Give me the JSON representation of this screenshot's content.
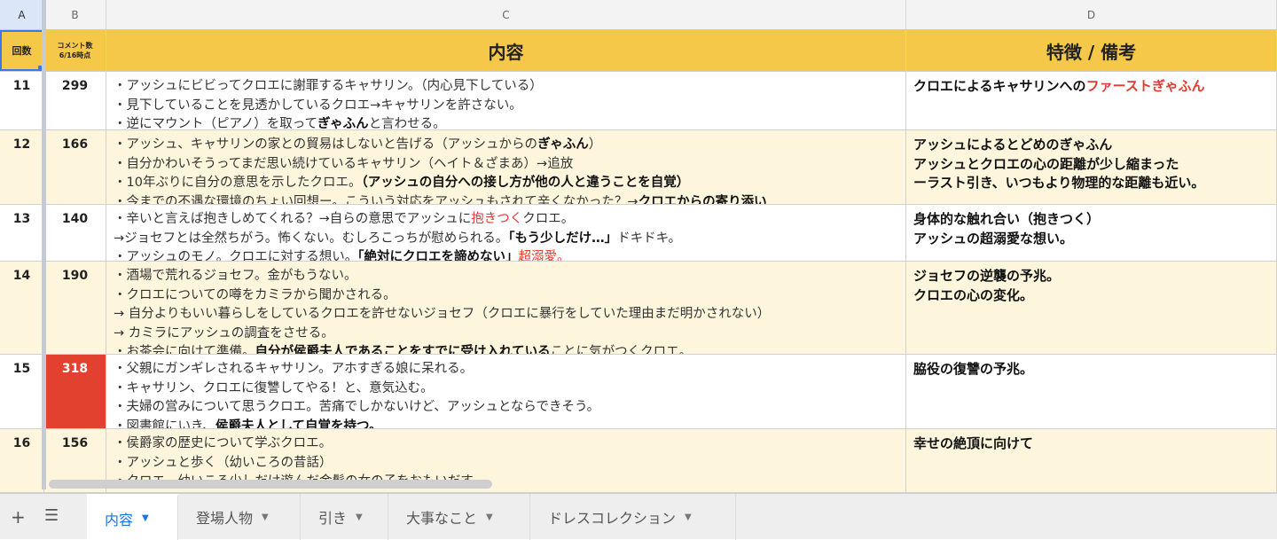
{
  "columns": [
    "A",
    "B",
    "C",
    "D"
  ],
  "header": {
    "a": "回数",
    "b_line1": "コメント数",
    "b_line2": "6/16時点",
    "c": "内容",
    "d": "特徴 / 備考"
  },
  "rows": [
    {
      "num": "11",
      "comments": "299",
      "lines": [
        [
          {
            "t": "・アッシュにビビってクロエに謝罪するキャサリン。（内心見下している）"
          }
        ],
        [
          {
            "t": "・見下していることを見透かしているクロエ→キャサリンを許さない。"
          }
        ],
        [
          {
            "t": "・逆にマウント（ピアノ）を取って"
          },
          {
            "t": "ぎゃふん",
            "s": "b"
          },
          {
            "t": "と言わせる。"
          }
        ]
      ],
      "feat": [
        [
          {
            "t": "クロエによるキャサリンへの"
          },
          {
            "t": "ファーストぎゃふん",
            "s": "red"
          }
        ]
      ]
    },
    {
      "num": "12",
      "comments": "166",
      "lines": [
        [
          {
            "t": "・アッシュ、キャサリンの家との貿易はしないと告げる（アッシュからの"
          },
          {
            "t": "ぎゃふん",
            "s": "b"
          },
          {
            "t": "）"
          }
        ],
        [
          {
            "t": "・自分かわいそうってまだ思い続けているキャサリン（ヘイト＆ざまあ）→追放"
          }
        ],
        [
          {
            "t": "・10年ぶりに自分の意思を示したクロエ。"
          },
          {
            "t": "（アッシュの自分への接し方が他の人と違うことを自覚）",
            "s": "b"
          }
        ],
        [
          {
            "t": "・今までの不遇な環境のちょい回想ー。こういう対応をアッシュもされて辛くなかった？→"
          },
          {
            "t": "クロエからの寄り添い",
            "s": "b"
          }
        ]
      ],
      "feat": [
        [
          {
            "t": "アッシュによるとどめのぎゃふん"
          }
        ],
        [
          {
            "t": "アッシュとクロエの心の距離が少し縮まった"
          }
        ],
        [
          {
            "t": "ーラスト引き、いつもより物理的な距離も近い。"
          }
        ]
      ]
    },
    {
      "num": "13",
      "comments": "140",
      "lines": [
        [
          {
            "t": "・辛いと言えば抱きしめてくれる？→自らの意思でアッシュに"
          },
          {
            "t": "抱きつく",
            "s": "red"
          },
          {
            "t": "クロエ。"
          }
        ],
        [
          {
            "t": "→ジョセフとは全然ちがう。怖くない。むしろこっちが慰められる。"
          },
          {
            "t": "「もう少しだけ…」",
            "s": "b"
          },
          {
            "t": "ドキドキ。"
          }
        ],
        [
          {
            "t": "・アッシュのモノ。クロエに対する想い。"
          },
          {
            "t": "「絶対にクロエを諦めない」",
            "s": "b"
          },
          {
            "t": "超溺愛。",
            "s": "red"
          }
        ]
      ],
      "feat": [
        [
          {
            "t": "身体的な触れ合い（抱きつく）"
          }
        ],
        [
          {
            "t": "アッシュの超溺愛な想い。"
          }
        ]
      ]
    },
    {
      "num": "14",
      "comments": "190",
      "lines": [
        [
          {
            "t": "・酒場で荒れるジョセフ。金がもうない。"
          }
        ],
        [
          {
            "t": "・クロエについての噂をカミラから聞かされる。"
          }
        ],
        [
          {
            "t": "→ 自分よりもいい暮らしをしているクロエを許せないジョセフ（クロエに暴行をしていた理由まだ明かされない）"
          }
        ],
        [
          {
            "t": "→ カミラにアッシュの調査をさせる。"
          }
        ],
        [
          {
            "t": "・お茶会に向けて準備。"
          },
          {
            "t": "自分が侯爵夫人であることをすでに受け入れている",
            "s": "b"
          },
          {
            "t": "ことに気がつくクロエ。"
          }
        ]
      ],
      "feat": [
        [
          {
            "t": "ジョセフの逆襲の予兆。"
          }
        ],
        [
          {
            "t": "クロエの心の変化。"
          }
        ]
      ]
    },
    {
      "num": "15",
      "comments": "318",
      "highlight": true,
      "lines": [
        [
          {
            "t": "・父親にガンギレされるキャサリン。アホすぎる娘に呆れる。"
          }
        ],
        [
          {
            "t": "・キャサリン、クロエに復讐してやる！と、意気込む。"
          }
        ],
        [
          {
            "t": "・夫婦の営みについて思うクロエ。苦痛でしかないけど、アッシュとならできそう。"
          }
        ],
        [
          {
            "t": "・図書館にいき、"
          },
          {
            "t": "侯爵夫人として自覚を持つ。",
            "s": "b"
          }
        ]
      ],
      "feat": [
        [
          {
            "t": "脇役の復讐の予兆。"
          }
        ]
      ]
    },
    {
      "num": "16",
      "comments": "156",
      "lines": [
        [
          {
            "t": "・侯爵家の歴史について学ぶクロエ。"
          }
        ],
        [
          {
            "t": "・アッシュと歩く（幼いころの昔話）"
          }
        ],
        [
          {
            "t": "・クロエ、幼いころ少しだけ遊んだ金髪の女の子をおもいだす。"
          }
        ]
      ],
      "feat": [
        [
          {
            "t": "幸せの絶頂に向けて"
          }
        ]
      ]
    }
  ],
  "tabs": [
    "内容",
    "登場人物",
    "引き",
    "大事なこと",
    "ドレスコレクション"
  ],
  "active_tab": 0,
  "colors": {
    "header": "#f6c84a",
    "alt_row": "#fdf5dc",
    "highlight": "#e2412f",
    "accent_red": "#e23a2e",
    "tab_active": "#1a73e8"
  },
  "icons": {
    "add": "plus-icon",
    "all_sheets": "menu-icon",
    "tab_dropdown": "caret-down-icon"
  }
}
